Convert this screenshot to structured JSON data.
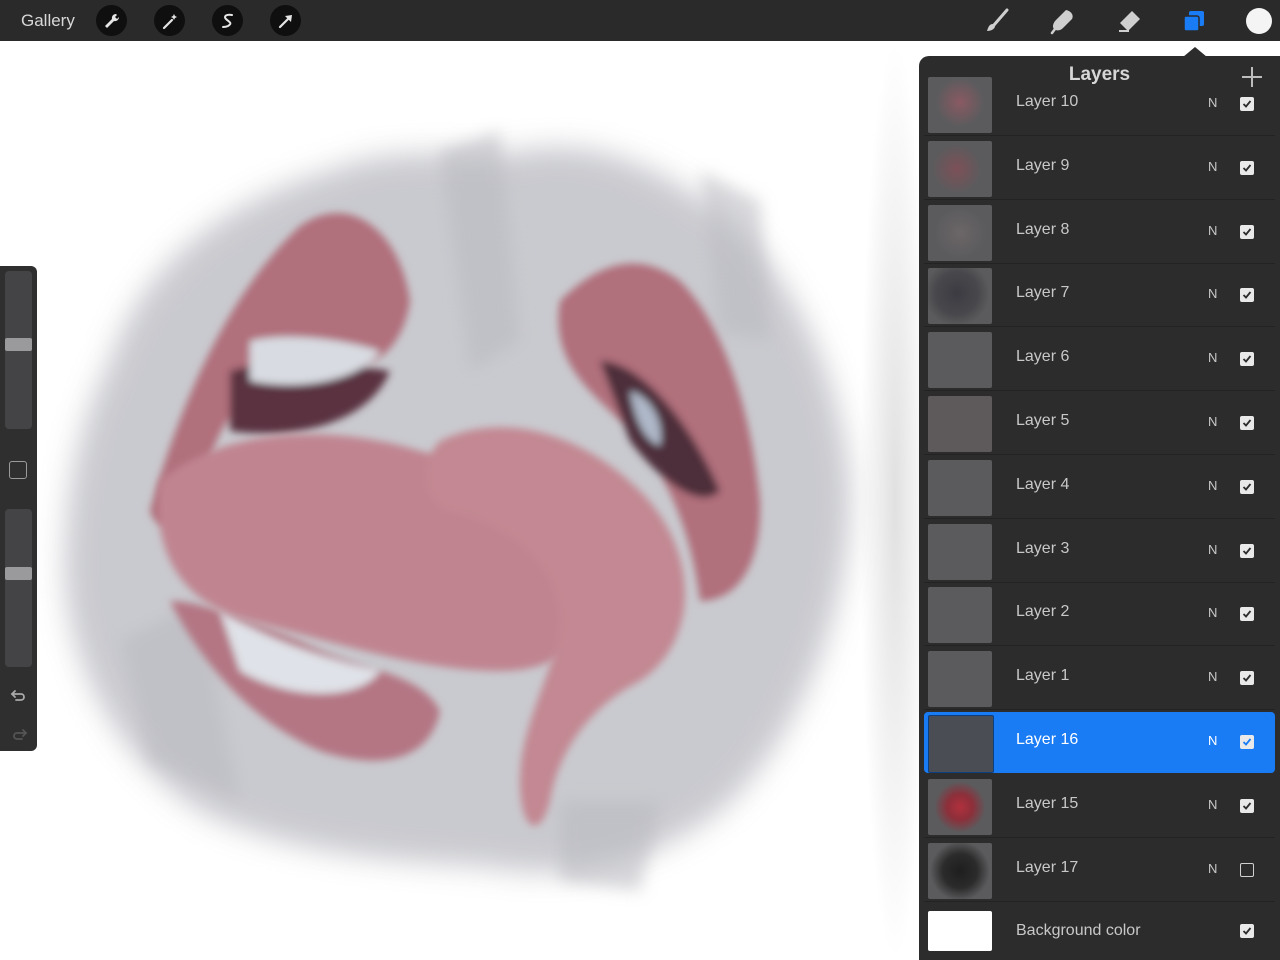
{
  "topbar": {
    "gallery_label": "Gallery",
    "left_tools": [
      "wrench-icon",
      "magic-wand-icon",
      "selection-icon",
      "transform-arrow-icon"
    ],
    "right_tools": [
      "brush-icon",
      "smudge-icon",
      "eraser-icon",
      "layers-icon",
      "color-icon"
    ],
    "active_tool": "layers-icon",
    "accent_color": "#1a7cf5",
    "current_color": "#f4f4f4"
  },
  "sidebar": {
    "brush_size_level": 0.42,
    "opacity_level": 0.62,
    "icons": [
      "modify-button-icon",
      "undo-icon",
      "redo-icon"
    ]
  },
  "layers_panel": {
    "title": "Layers",
    "add_icon": "plus-icon",
    "layers": [
      {
        "name": "Layer 10",
        "mode": "N",
        "visible": true,
        "selected": false
      },
      {
        "name": "Layer 9",
        "mode": "N",
        "visible": true,
        "selected": false
      },
      {
        "name": "Layer 8",
        "mode": "N",
        "visible": true,
        "selected": false
      },
      {
        "name": "Layer 7",
        "mode": "N",
        "visible": true,
        "selected": false
      },
      {
        "name": "Layer 6",
        "mode": "N",
        "visible": true,
        "selected": false
      },
      {
        "name": "Layer 5",
        "mode": "N",
        "visible": true,
        "selected": false
      },
      {
        "name": "Layer 4",
        "mode": "N",
        "visible": true,
        "selected": false
      },
      {
        "name": "Layer 3",
        "mode": "N",
        "visible": true,
        "selected": false
      },
      {
        "name": "Layer 2",
        "mode": "N",
        "visible": true,
        "selected": false
      },
      {
        "name": "Layer 1",
        "mode": "N",
        "visible": true,
        "selected": false
      },
      {
        "name": "Layer 16",
        "mode": "N",
        "visible": true,
        "selected": true
      },
      {
        "name": "Layer 15",
        "mode": "N",
        "visible": true,
        "selected": false
      },
      {
        "name": "Layer 17",
        "mode": "N",
        "visible": false,
        "selected": false
      }
    ],
    "background": {
      "name": "Background color",
      "visible": true
    }
  }
}
